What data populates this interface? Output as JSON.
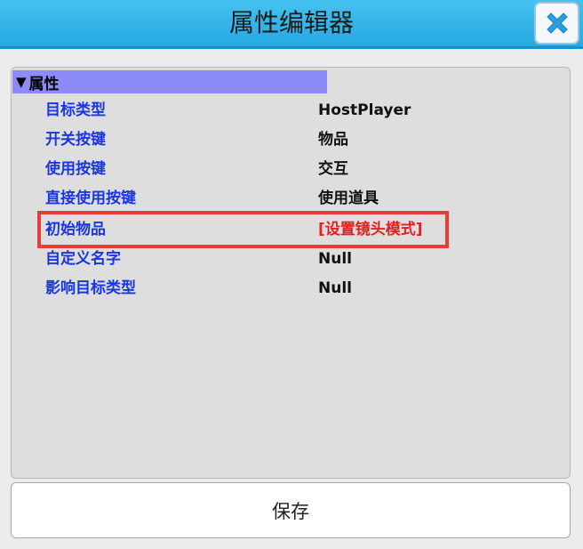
{
  "window": {
    "title": "属性编辑器",
    "close_icon": "close-x-icon"
  },
  "section": {
    "arrow": "▼",
    "label": "属性"
  },
  "properties": [
    {
      "name": "目标类型",
      "value": "HostPlayer"
    },
    {
      "name": "开关按键",
      "value": "物品"
    },
    {
      "name": "使用按键",
      "value": "交互"
    },
    {
      "name": "直接使用按键",
      "value": "使用道具"
    },
    {
      "name": "初始物品",
      "value": "[设置镜头模式]"
    },
    {
      "name": "自定义名字",
      "value": "Null"
    },
    {
      "name": "影响目标类型",
      "value": "Null"
    }
  ],
  "highlighted_property": "初始物品",
  "save_label": "保存",
  "colors": {
    "titlebar": "#2aabe4",
    "section_header": "#8d8cf6",
    "property_name": "#1a36e0",
    "highlight_value": "#e81e1e",
    "highlight_border": "#ea3a3a"
  }
}
